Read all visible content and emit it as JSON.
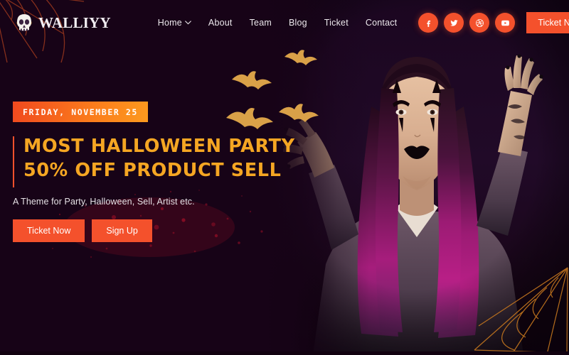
{
  "site": {
    "background_color": "#190419",
    "accent_color": "#f4512c",
    "headline_color": "#f5a623"
  },
  "header": {
    "brand": {
      "name": "WALLIYY",
      "icon": "skull-icon"
    },
    "nav": [
      {
        "label": "Home",
        "has_dropdown": true,
        "icon": "chevron-down-icon"
      },
      {
        "label": "About",
        "has_dropdown": false
      },
      {
        "label": "Team",
        "has_dropdown": false
      },
      {
        "label": "Blog",
        "has_dropdown": false
      },
      {
        "label": "Ticket",
        "has_dropdown": false
      },
      {
        "label": "Contact",
        "has_dropdown": false
      }
    ],
    "socials": [
      {
        "name": "facebook-icon",
        "label": "Facebook"
      },
      {
        "name": "twitter-icon",
        "label": "Twitter"
      },
      {
        "name": "dribbble-icon",
        "label": "Dribbble"
      },
      {
        "name": "youtube-icon",
        "label": "YouTube"
      }
    ],
    "cta_label": "Ticket Now"
  },
  "hero": {
    "date_badge": "FRIDAY, NOVEMBER 25",
    "headline_line1": "MOST HALLOWEEN PARTY",
    "headline_line2": "50% OFF PRODUCT SELL",
    "subtitle": "A Theme for Party, Halloween, Sell, Artist etc.",
    "primary_cta": "Ticket Now",
    "secondary_cta": "Sign Up",
    "decorations": {
      "bats_count": 4,
      "web_top_left": "spider-web-icon",
      "web_bottom_right": "spider-web-icon",
      "photo_alt": "Woman with Halloween clown makeup and magenta hair raising clawed hands"
    }
  }
}
